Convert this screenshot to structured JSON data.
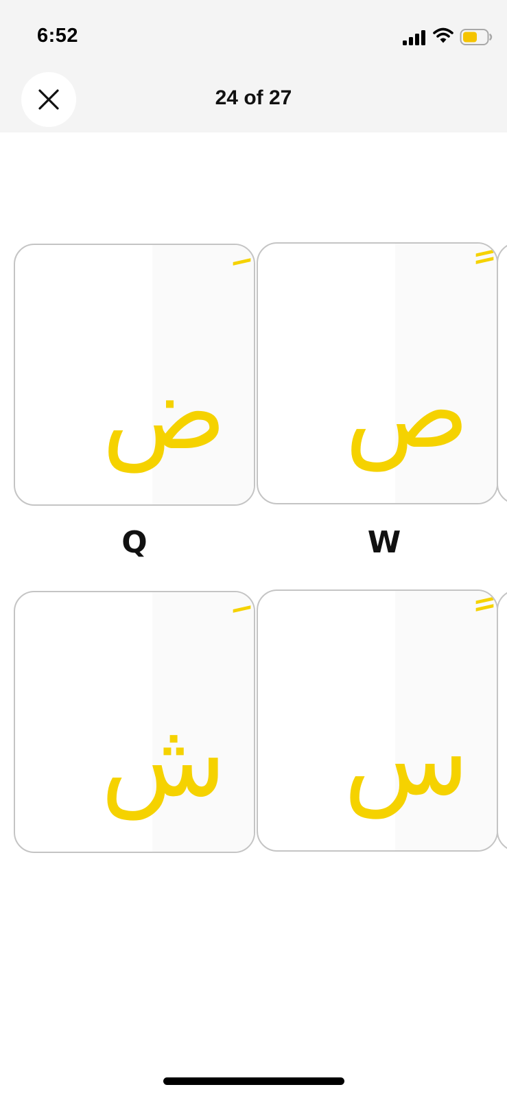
{
  "status_bar": {
    "time": "6:52",
    "icons": [
      "signal-icon",
      "wifi-icon",
      "battery-icon"
    ],
    "battery_color": "#f5c400"
  },
  "nav": {
    "close_icon": "close-icon",
    "page_counter": "24 of 27"
  },
  "image": {
    "accent_color": "#f5d200",
    "keys": [
      {
        "letter": "ض",
        "diacritic": "َ",
        "latin": "Q"
      },
      {
        "letter": "ص",
        "diacritic": "ً",
        "latin": "W"
      },
      {
        "letter": "ش",
        "diacritic": "َ",
        "latin": ""
      },
      {
        "letter": "س",
        "diacritic": "ً",
        "latin": ""
      }
    ]
  }
}
